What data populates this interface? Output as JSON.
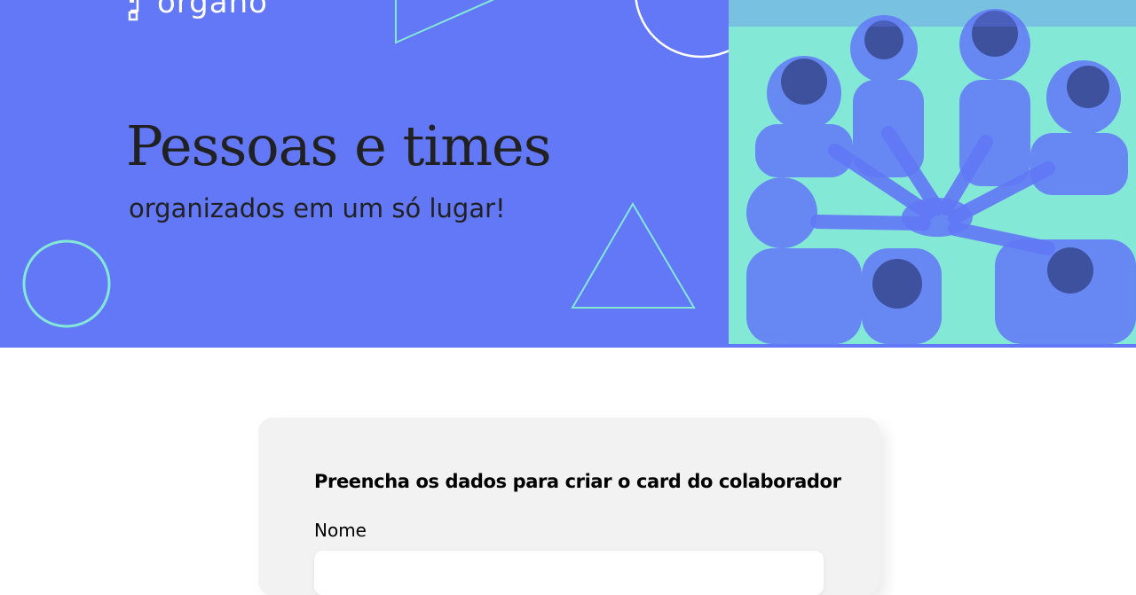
{
  "banner": {
    "logo_text": "organo",
    "headline": "Pessoas e times",
    "subheadline": "organizados em um só lugar!",
    "background_color": "#6278F7",
    "accent_color": "#84E8D6",
    "photo": "group-of-people-hands-together-image"
  },
  "form": {
    "title": "Preencha os dados para criar o card do colaborador",
    "fields": [
      {
        "label": "Nome",
        "value": "",
        "placeholder": ""
      }
    ]
  }
}
